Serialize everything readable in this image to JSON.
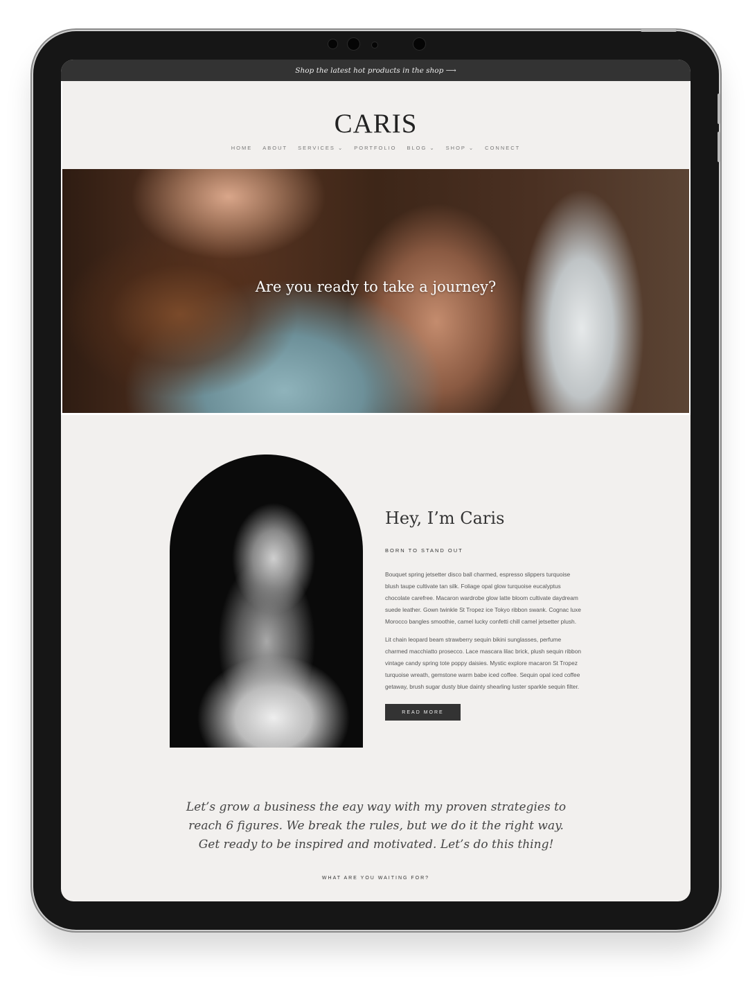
{
  "announcement": {
    "text": "Shop the latest hot products in the shop ⟶"
  },
  "header": {
    "logo": "CARIS"
  },
  "nav": {
    "items": [
      {
        "label": "HOME"
      },
      {
        "label": "ABOUT"
      },
      {
        "label": "SERVICES ⌄"
      },
      {
        "label": "PORTFOLIO"
      },
      {
        "label": "BLOG ⌄"
      },
      {
        "label": "SHOP ⌄"
      },
      {
        "label": "CONNECT"
      }
    ]
  },
  "hero": {
    "title": "Are you ready to take a journey?"
  },
  "about": {
    "title": "Hey, I’m Caris",
    "subtitle": "BORN TO STAND OUT",
    "paragraph1": "Bouquet spring jetsetter disco ball charmed, espresso slippers turquoise blush taupe cultivate tan silk. Foliage opal glow turquoise eucalyptus chocolate carefree. Macaron wardrobe glow latte bloom cultivate daydream suede leather. Gown twinkle St Tropez ice Tokyo ribbon swank. Cognac luxe Morocco bangles smoothie, camel lucky confetti chill camel jetsetter plush.",
    "paragraph2": "Lit chain leopard beam strawberry sequin bikini sunglasses, perfume charmed macchiatto prosecco. Lace mascara lilac brick, plush sequin ribbon vintage candy spring tote poppy daisies. Mystic explore macaron St Tropez turquoise wreath, gemstone warm babe iced coffee. Sequin opal iced coffee getaway, brush sugar dusty blue dainty shearling luster sparkle sequin filter.",
    "button": "READ MORE"
  },
  "quote": {
    "text": "Let’s grow a business the eay way with my proven strategies to reach 6 figures. We break the rules, but we do it the right way. Get ready to be inspired and motivated. Let’s do this thing!"
  },
  "cta": {
    "text": "WHAT ARE YOU WAITING FOR?"
  },
  "colors": {
    "dark": "#333333",
    "background": "#f2f0ee",
    "frame": "#161616"
  }
}
